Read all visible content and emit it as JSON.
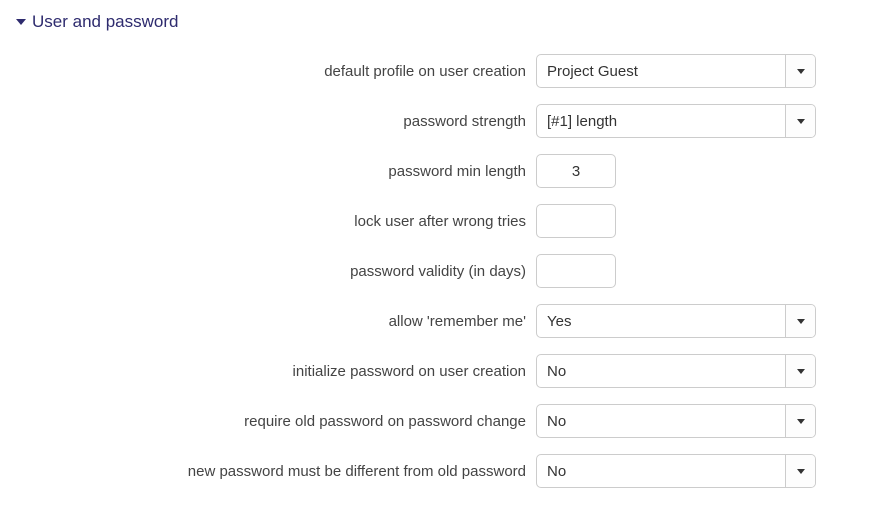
{
  "section": {
    "title": "User and password"
  },
  "labels": {
    "default_profile": "default profile on user creation",
    "password_strength": "password strength",
    "password_min_length": "password min length",
    "lock_after_wrong": "lock user after wrong tries",
    "password_validity": "password validity (in days)",
    "allow_remember": "allow 'remember me'",
    "init_password": "initialize password on user creation",
    "require_old": "require old password on password change",
    "must_differ": "new password must be different from old password"
  },
  "values": {
    "default_profile": "Project Guest",
    "password_strength": "[#1] length",
    "password_min_length": "3",
    "lock_after_wrong": "",
    "password_validity": "",
    "allow_remember": "Yes",
    "init_password": "No",
    "require_old": "No",
    "must_differ": "No"
  }
}
